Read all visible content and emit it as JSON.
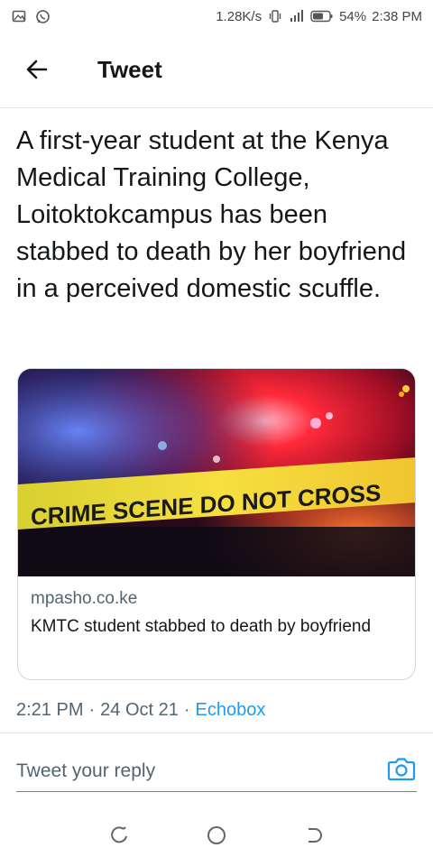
{
  "status_bar": {
    "speed": "1.28K/s",
    "battery": "54%",
    "time": "2:38 PM"
  },
  "header": {
    "title": "Tweet"
  },
  "tweet": {
    "text": "A first-year student at the Kenya Medical Training College, Loitoktokcampus has been stabbed to death by her boyfriend in a perceived domestic scuffle.",
    "timestamp": "2:21 PM",
    "date": "24 Oct 21",
    "source": "Echobox",
    "separator": "·"
  },
  "card": {
    "image_text": "CRIME SCENE DO NOT CROSS",
    "domain": "mpasho.co.ke",
    "title": "KMTC student stabbed to death by boyfriend"
  },
  "reply": {
    "placeholder": "Tweet your reply"
  },
  "colors": {
    "accent": "#1d9bf0",
    "secondary_text": "#536471",
    "tape": "#f2d22a"
  },
  "icons": {
    "back": "arrow-left-icon",
    "camera": "camera-icon",
    "nav_recent": "recent-apps-icon",
    "nav_home": "home-circle-icon",
    "nav_back": "nav-back-icon"
  }
}
